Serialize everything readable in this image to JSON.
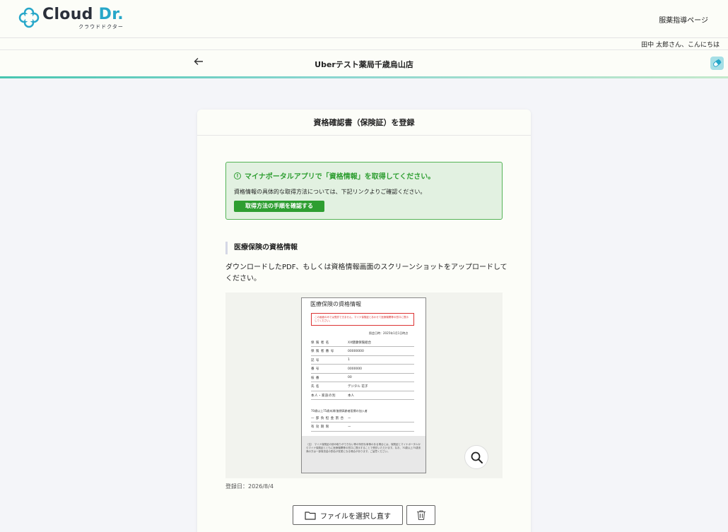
{
  "header": {
    "logo_word_main": "Cloud ",
    "logo_word_accent": "Dr.",
    "logo_sub": "クラウドドクター",
    "guide_link": "服薬指導ページ",
    "greeting": "田中 太郎さん、こんにちは"
  },
  "store": {
    "name": "Uberテスト薬局千歳烏山店"
  },
  "card": {
    "title": "資格確認書（保険証）を登録",
    "notice": {
      "title": "マイナポータルアプリで「資格情報」を取得してください。",
      "body": "資格情報の具体的な取得方法については、下記リンクよりご確認ください。",
      "button": "取得方法の手順を確認する"
    },
    "section_title": "医療保険の資格情報",
    "description": "ダウンロードしたPDF、もしくは資格情報画面のスクリーンショットをアップロードしてください。",
    "document": {
      "title": "医療保険の資格情報",
      "warning": "この画面のみでは受診できません。マイナ保険証とあわせて医療機関等の窓口に提示してください。",
      "date": "照会日時：2025年1月1日時点",
      "rows": [
        {
          "label": "保 険 者 名",
          "value": "XX健康保険組合"
        },
        {
          "label": "保 険 者 番 号",
          "value": "00000000"
        },
        {
          "label": "記 号",
          "value": "1"
        },
        {
          "label": "番 号",
          "value": "0000000"
        },
        {
          "label": "枝 番",
          "value": "00"
        },
        {
          "label": "氏 名",
          "value": "デジタル 花子"
        },
        {
          "label": "本人・家族の別",
          "value": "本人"
        }
      ],
      "note": "70歳以上75歳未満(後期高齢者医療の加入者",
      "rows2": [
        {
          "label": "一 部 負 担 金 割 合",
          "value": "ー"
        },
        {
          "label": "有 効 期 限",
          "value": "ー"
        }
      ],
      "footnote": "（注） マイナ保険証の読み取りができない等の特別な事情のある場合には、保険証とマイナポータルからマイナ保険証とともに医療機関等の窓口に提示することで受診いただけます。なお、70歳以上75歳未満の方は一部負担金の割合が変更になる場合があります。ご留意ください。"
    },
    "registered_date": "登録日：2026/8/4",
    "reselect_button": "ファイルを選択し直す"
  },
  "colors": {
    "accent_green": "#2e9e31",
    "logo_blue": "#27a7c9",
    "gradient": [
      "#47c6b0",
      "#c4e9cb"
    ]
  },
  "icons": [
    "back-arrow-icon",
    "pill-icon",
    "info-icon",
    "zoom-icon",
    "folder-icon",
    "trash-icon"
  ]
}
